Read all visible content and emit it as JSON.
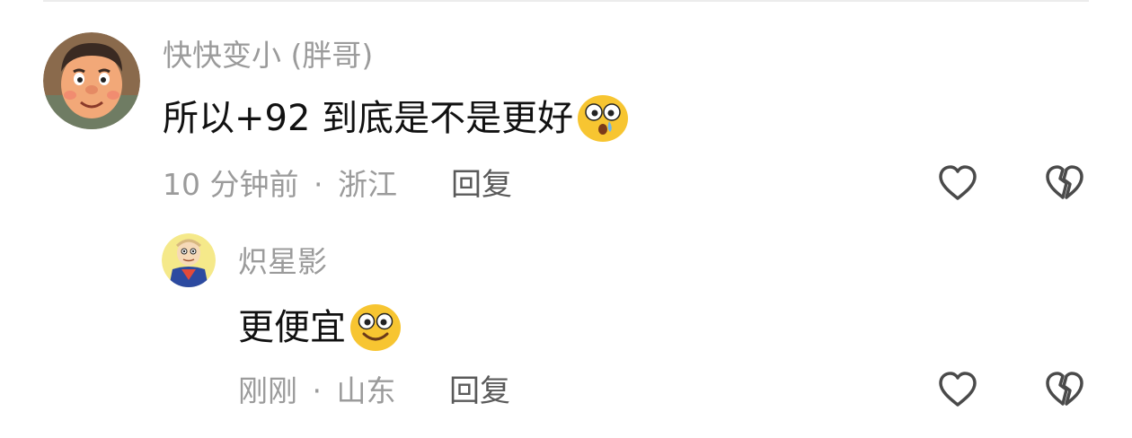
{
  "comments": [
    {
      "username": "快快变小 (胖哥)",
      "text": "所以+92 到底是不是更好",
      "emoji": "surprised-face-icon",
      "time": "10 分钟前",
      "separator": "·",
      "location": "浙江",
      "reply_label": "回复"
    },
    {
      "username": "炽星影",
      "text": "更便宜",
      "emoji": "smiling-face-icon",
      "time": "刚刚",
      "separator": "·",
      "location": "山东",
      "reply_label": "回复"
    }
  ],
  "colors": {
    "meta_text": "#9b9b9b",
    "body_text": "#111111",
    "reply_text": "#5a5a5a",
    "icon_stroke": "#4a4a4a",
    "emoji_yellow": "#f7c531"
  }
}
